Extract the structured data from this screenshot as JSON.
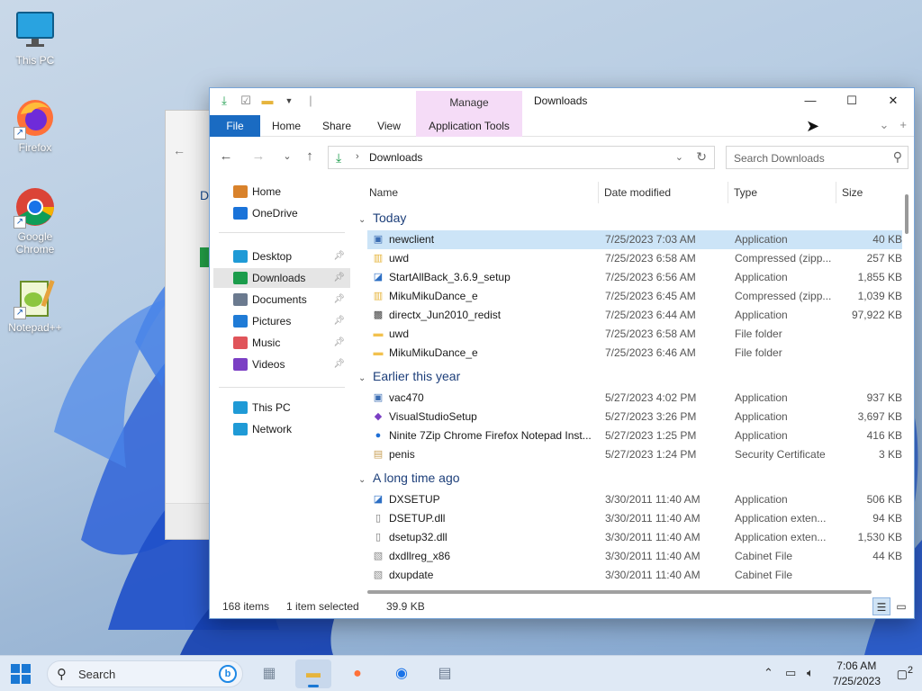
{
  "desktop": {
    "icons": [
      {
        "label": "This PC",
        "icon": "monitor-icon"
      },
      {
        "label": "Firefox",
        "icon": "firefox-icon"
      },
      {
        "label": "Google Chrome",
        "icon": "chrome-icon"
      },
      {
        "label": "Notepad++",
        "icon": "notepadpp-icon"
      }
    ]
  },
  "window": {
    "title": "Downloads",
    "context_tab": "Manage",
    "ribbon_tabs": [
      "File",
      "Home",
      "Share",
      "View",
      "Application Tools"
    ],
    "address": {
      "path": "Downloads"
    },
    "search": {
      "placeholder": "Search Downloads"
    }
  },
  "sidebar": {
    "items": [
      {
        "label": "Home",
        "icon": "home-icon",
        "color": "#d9822b"
      },
      {
        "label": "OneDrive",
        "icon": "cloud-icon",
        "color": "#1a73d9"
      },
      {
        "label": "Desktop",
        "icon": "desktop-icon",
        "color": "#1f9ad6",
        "pinned": true
      },
      {
        "label": "Downloads",
        "icon": "download-icon",
        "color": "#1b9c4b",
        "pinned": true,
        "active": true
      },
      {
        "label": "Documents",
        "icon": "document-icon",
        "color": "#6b7a8f",
        "pinned": true
      },
      {
        "label": "Pictures",
        "icon": "picture-icon",
        "color": "#1f7bd6",
        "pinned": true
      },
      {
        "label": "Music",
        "icon": "music-icon",
        "color": "#e0545a",
        "pinned": true
      },
      {
        "label": "Videos",
        "icon": "video-icon",
        "color": "#7b3fc4",
        "pinned": true
      },
      {
        "label": "This PC",
        "icon": "pc-icon",
        "color": "#1f9ad6"
      },
      {
        "label": "Network",
        "icon": "network-icon",
        "color": "#1f9ad6"
      }
    ]
  },
  "columns": [
    "Name",
    "Date modified",
    "Type",
    "Size"
  ],
  "groups": [
    {
      "label": "Today",
      "files": [
        {
          "name": "newclient",
          "date": "7/25/2023 7:03 AM",
          "type": "Application",
          "size": "40 KB",
          "icon": "app-icon",
          "selected": true
        },
        {
          "name": "uwd",
          "date": "7/25/2023 6:58 AM",
          "type": "Compressed (zipp...",
          "size": "257 KB",
          "icon": "zip-icon"
        },
        {
          "name": "StartAllBack_3.6.9_setup",
          "date": "7/25/2023 6:56 AM",
          "type": "Application",
          "size": "1,855 KB",
          "icon": "setup-icon"
        },
        {
          "name": "MikuMikuDance_e",
          "date": "7/25/2023 6:45 AM",
          "type": "Compressed (zipp...",
          "size": "1,039 KB",
          "icon": "zip-icon"
        },
        {
          "name": "directx_Jun2010_redist",
          "date": "7/25/2023 6:44 AM",
          "type": "Application",
          "size": "97,922 KB",
          "icon": "directx-icon"
        },
        {
          "name": "uwd",
          "date": "7/25/2023 6:58 AM",
          "type": "File folder",
          "size": "",
          "icon": "folder-icon"
        },
        {
          "name": "MikuMikuDance_e",
          "date": "7/25/2023 6:46 AM",
          "type": "File folder",
          "size": "",
          "icon": "folder-icon"
        }
      ]
    },
    {
      "label": "Earlier this year",
      "files": [
        {
          "name": "vac470",
          "date": "5/27/2023 4:02 PM",
          "type": "Application",
          "size": "937 KB",
          "icon": "app-icon"
        },
        {
          "name": "VisualStudioSetup",
          "date": "5/27/2023 3:26 PM",
          "type": "Application",
          "size": "3,697 KB",
          "icon": "vs-icon"
        },
        {
          "name": "Ninite 7Zip Chrome Firefox Notepad Inst...",
          "date": "5/27/2023 1:25 PM",
          "type": "Application",
          "size": "416 KB",
          "icon": "ninite-icon"
        },
        {
          "name": "penis",
          "date": "5/27/2023 1:24 PM",
          "type": "Security Certificate",
          "size": "3 KB",
          "icon": "certificate-icon"
        }
      ]
    },
    {
      "label": "A long time ago",
      "files": [
        {
          "name": "DXSETUP",
          "date": "3/30/2011 11:40 AM",
          "type": "Application",
          "size": "506 KB",
          "icon": "setup-icon"
        },
        {
          "name": "DSETUP.dll",
          "date": "3/30/2011 11:40 AM",
          "type": "Application exten...",
          "size": "94 KB",
          "icon": "dll-icon"
        },
        {
          "name": "dsetup32.dll",
          "date": "3/30/2011 11:40 AM",
          "type": "Application exten...",
          "size": "1,530 KB",
          "icon": "dll-icon"
        },
        {
          "name": "dxdllreg_x86",
          "date": "3/30/2011 11:40 AM",
          "type": "Cabinet File",
          "size": "44 KB",
          "icon": "cab-icon"
        },
        {
          "name": "dxupdate",
          "date": "3/30/2011 11:40 AM",
          "type": "Cabinet File",
          "size": "",
          "icon": "cab-icon"
        }
      ]
    }
  ],
  "status": {
    "count": "168 items",
    "selected": "1 item selected",
    "size": "39.9 KB"
  },
  "taskbar": {
    "search_label": "Search",
    "time": "7:06 AM",
    "date": "7/25/2023",
    "notifications": "2"
  },
  "colors": {
    "accent": "#1a6bc2",
    "selection": "#cce4f7",
    "context": "#f5dcf7"
  }
}
